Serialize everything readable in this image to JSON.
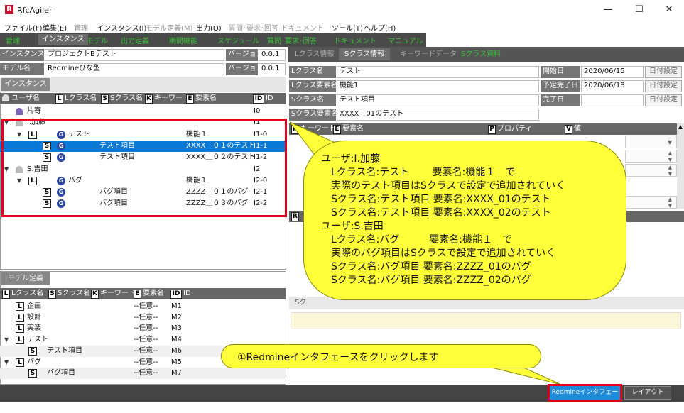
{
  "window": {
    "title": "RfcAgiler",
    "app_icon": "R",
    "minimize": "—",
    "maximize": "☐",
    "close": "✕"
  },
  "menu": [
    {
      "label": "ファイル(F)",
      "enabled": true
    },
    {
      "label": "編集(E)",
      "enabled": true
    },
    {
      "label": "管理",
      "enabled": false
    },
    {
      "label": "インスタンス(I)",
      "enabled": true
    },
    {
      "label": "モデル定義(M)",
      "enabled": false
    },
    {
      "label": "出力(O)",
      "enabled": true
    },
    {
      "label": "質問･要求･回答",
      "enabled": false
    },
    {
      "label": "ドキュメント",
      "enabled": false
    },
    {
      "label": "ツール(T)",
      "enabled": true
    },
    {
      "label": "ヘルプ(H)",
      "enabled": true
    }
  ],
  "main_tabs": [
    "管理",
    "インスタンス",
    "モデル",
    "出力定義",
    "期間機能",
    "スケジュール",
    "質問･要求･回答",
    "ドキュメント",
    "マニュアル"
  ],
  "instance": {
    "name_label": "インスタンス名",
    "name_value": "プロジェクトBテスト",
    "version_label": "バージョン",
    "version_value": "0.0.1",
    "model_label": "モデル名",
    "model_value": "Redmineひな型",
    "model_version_label": "バージョン",
    "model_version_value": "0.0.1"
  },
  "instance_panel": {
    "title": "インスタンス",
    "headers": {
      "user": "ユーザ名",
      "l_class": "Lクラス名",
      "s_class": "Sクラス名",
      "keyword": "キーワード",
      "element": "要素名",
      "id": "ID"
    }
  },
  "tree": [
    {
      "level": 0,
      "kind": "user",
      "name": "片寄",
      "element": "",
      "id": "I0",
      "expanded": false
    },
    {
      "level": 0,
      "kind": "user",
      "name": "I.加藤",
      "element": "",
      "id": "I1",
      "expanded": true
    },
    {
      "level": 1,
      "kind": "L",
      "name": "テスト",
      "element": "機能１",
      "id": "I1-0",
      "expanded": true
    },
    {
      "level": 2,
      "kind": "S",
      "name": "テスト項目",
      "element": "XXXX＿０１のテスト",
      "id": "I1-1",
      "selected": true
    },
    {
      "level": 2,
      "kind": "S",
      "name": "テスト項目",
      "element": "XXXX＿０２のテスト",
      "id": "I1-2"
    },
    {
      "level": 0,
      "kind": "user",
      "name": "S.吉田",
      "element": "",
      "id": "I2",
      "expanded": true
    },
    {
      "level": 1,
      "kind": "L",
      "name": "バグ",
      "element": "機能１",
      "id": "I2-0",
      "expanded": true
    },
    {
      "level": 2,
      "kind": "S",
      "name": "バグ項目",
      "element": "ZZZZ＿０１のバグ",
      "id": "I2-1"
    },
    {
      "level": 2,
      "kind": "S",
      "name": "バグ項目",
      "element": "ZZZZ＿０３のバグ",
      "id": "I2-2"
    }
  ],
  "model_panel": {
    "title": "モデル定義",
    "headers": {
      "l_class": "Lクラス名",
      "s_class": "Sクラス名",
      "keyword": "キーワード",
      "element": "要素名",
      "id": "ID"
    }
  },
  "model_tree": [
    {
      "level": 0,
      "kind": "L",
      "name": "企画",
      "element": "--任意--",
      "id": "M1",
      "expandable": false
    },
    {
      "level": 0,
      "kind": "L",
      "name": "設計",
      "element": "--任意--",
      "id": "M2",
      "expandable": false
    },
    {
      "level": 0,
      "kind": "L",
      "name": "実装",
      "element": "--任意--",
      "id": "M3",
      "expandable": false
    },
    {
      "level": 0,
      "kind": "L",
      "name": "テスト",
      "element": "--任意--",
      "id": "M4",
      "expandable": true
    },
    {
      "level": 1,
      "kind": "S",
      "name": "テスト項目",
      "element": "--任意--",
      "id": "M6"
    },
    {
      "level": 0,
      "kind": "L",
      "name": "バグ",
      "element": "--任意--",
      "id": "M5",
      "expandable": true
    },
    {
      "level": 1,
      "kind": "S",
      "name": "バグ項目",
      "element": "--任意--",
      "id": "M7"
    }
  ],
  "right_tabs": [
    "Lクラス情報",
    "Sクラス情報",
    "キーワードデータ",
    "Sクラス資料"
  ],
  "detail": {
    "l_class_label": "Lクラス名",
    "l_class_value": "テスト",
    "l_element_label": "Lクラス要素名",
    "l_element_value": "機能1",
    "s_class_label": "Sクラス名",
    "s_class_value": "テスト項目",
    "s_element_label": "Sクラス要素名",
    "s_element_value": "XXXX＿01のテスト",
    "start_label": "開始日",
    "start_value": "2020/06/15",
    "planned_label": "予定完了日",
    "planned_value": "2020/06/18",
    "done_label": "完了日",
    "done_value": "",
    "date_btn": "日付設定"
  },
  "kw_headers": {
    "keyword": "キーワード",
    "element": "要素名",
    "property": "プロパティ",
    "value": "値"
  },
  "callout1": {
    "lines": [
      "ユーザ:I.加藤",
      "　Lクラス名:テスト　　 要素名:機能１　で",
      "　実際のテスト項目はSクラスで設定で追加されていく",
      "　Sクラス名:テスト項目 要素名:XXXX_01のテスト",
      "　Sクラス名:テスト項目 要素名:XXXX_02のテスト",
      "ユーザ:S.吉田",
      "　Lクラス名:バグ　　　要素名:機能１　で",
      "　実際のバグ項目はSクラスで設定で追加されていく",
      "　Sクラス名:バグ項目 要素名:ZZZZ_01のバグ",
      "　Sクラス名:バグ項目 要素名:ZZZZ_02のバグ"
    ]
  },
  "callout2": {
    "text": "①Redmineインタフェースをクリックします"
  },
  "status": {
    "redmine_btn": "Redmineインタフェース",
    "layout_btn": "レイアウト"
  },
  "colors": {
    "highlight": "#e3001b",
    "callout": "#ffff3a",
    "selection": "#0a7ad6",
    "green_tab": "#39c139"
  }
}
